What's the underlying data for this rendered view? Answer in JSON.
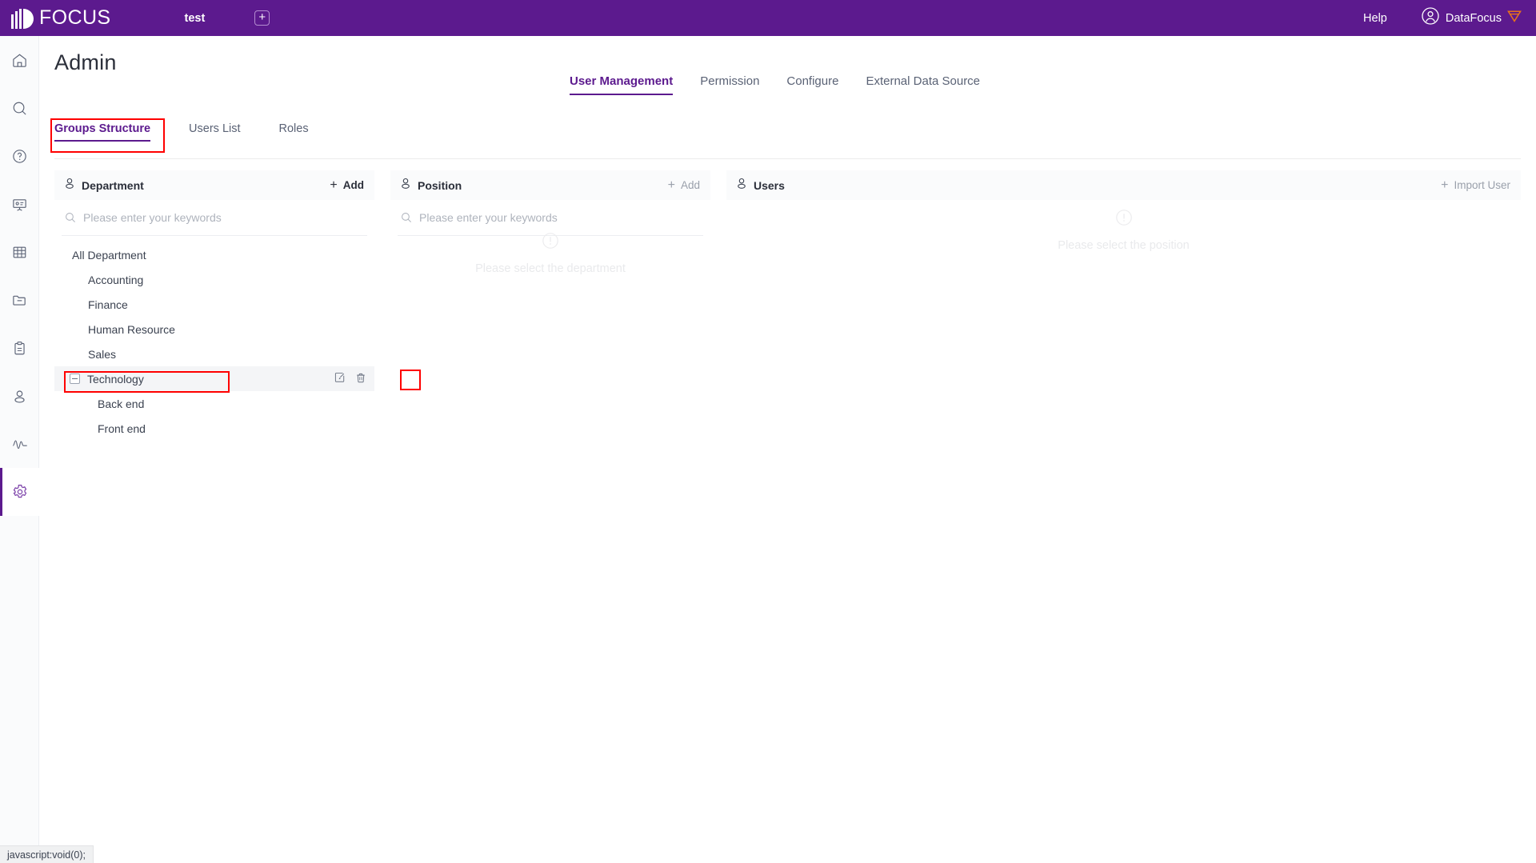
{
  "header": {
    "brand": "FOCUS",
    "tab_label": "test",
    "add_tab_label": "+",
    "help_label": "Help",
    "user_name": "DataFocus",
    "accent_color": "#5c1a8e",
    "badge_color": "#e8731a"
  },
  "sidebar": {
    "items": [
      {
        "icon": "home-icon",
        "active": false
      },
      {
        "icon": "search-icon",
        "active": false
      },
      {
        "icon": "question-circle-icon",
        "active": false
      },
      {
        "icon": "presentation-icon",
        "active": false
      },
      {
        "icon": "table-grid-icon",
        "active": false
      },
      {
        "icon": "folder-minus-icon",
        "active": false
      },
      {
        "icon": "clipboard-icon",
        "active": false
      },
      {
        "icon": "user-icon",
        "active": false
      },
      {
        "icon": "pulse-icon",
        "active": false
      },
      {
        "icon": "gear-icon",
        "active": true
      }
    ]
  },
  "page": {
    "title": "Admin"
  },
  "topnav": {
    "items": [
      {
        "label": "User Management",
        "active": true
      },
      {
        "label": "Permission",
        "active": false
      },
      {
        "label": "Configure",
        "active": false
      },
      {
        "label": "External Data Source",
        "active": false
      }
    ]
  },
  "subtabs": {
    "items": [
      {
        "label": "Groups Structure",
        "active": true
      },
      {
        "label": "Users List",
        "active": false
      },
      {
        "label": "Roles",
        "active": false
      }
    ]
  },
  "department_panel": {
    "title": "Department",
    "add_label": "Add",
    "add_plus": "+",
    "search_placeholder": "Please enter your keywords",
    "search_value": "",
    "tree": [
      {
        "label": "All Department",
        "indent": 0,
        "selected": false,
        "expandable": false
      },
      {
        "label": "Accounting",
        "indent": 1,
        "selected": false,
        "expandable": false
      },
      {
        "label": "Finance",
        "indent": 1,
        "selected": false,
        "expandable": false
      },
      {
        "label": "Human Resource",
        "indent": 1,
        "selected": false,
        "expandable": false
      },
      {
        "label": "Sales",
        "indent": 1,
        "selected": false,
        "expandable": false
      },
      {
        "label": "Technology",
        "indent": 1,
        "selected": true,
        "expandable": true
      },
      {
        "label": "Back end",
        "indent": 2,
        "selected": false,
        "expandable": false
      },
      {
        "label": "Front end",
        "indent": 2,
        "selected": false,
        "expandable": false
      }
    ]
  },
  "position_panel": {
    "title": "Position",
    "add_label": "Add",
    "add_plus": "+",
    "search_placeholder": "Please enter your keywords",
    "search_value": "",
    "empty_text": "Please select the department"
  },
  "users_panel": {
    "title": "Users",
    "import_label": "Import User",
    "import_plus": "+",
    "empty_text": "Please select the position"
  },
  "statusbar": {
    "text": "javascript:void(0);"
  },
  "annotations": {
    "color": "#ff0000",
    "boxes": [
      "groups-structure-tab",
      "technology-row",
      "delete-department-icon"
    ]
  }
}
